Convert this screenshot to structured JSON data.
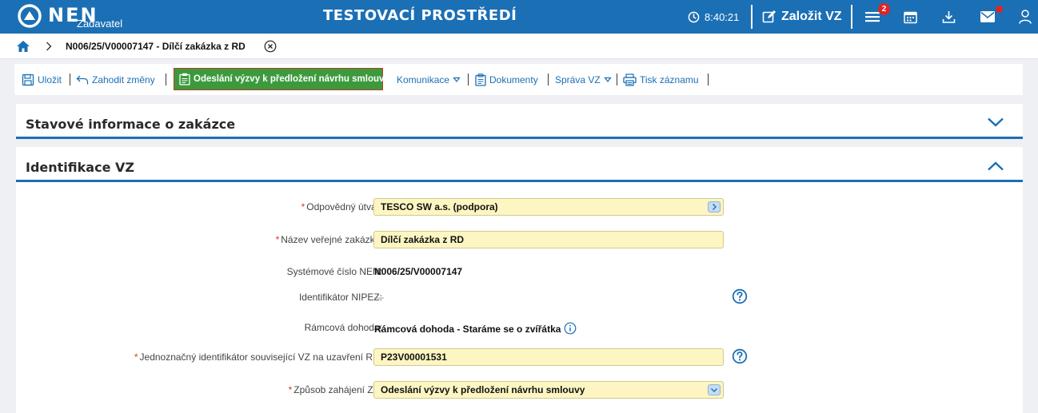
{
  "header": {
    "logo_text": "NEN",
    "logo_subtitle": "Zadavatel",
    "env_title": "TESTOVACÍ PROSTŘEDÍ",
    "clock": "8:40:21",
    "create_label": "Založit VZ",
    "menu_badge": "2"
  },
  "breadcrumb": {
    "current": "N006/25/V00007147 - Dílčí zakázka z RD"
  },
  "toolbar": {
    "save": "Uložit",
    "discard": "Zahodit změny",
    "send": "Odeslání výzvy k předložení návrhu smlouvy",
    "communication": "Komunikace",
    "documents": "Dokumenty",
    "manage": "Správa VZ",
    "print": "Tisk záznamu"
  },
  "panels": {
    "status_title": "Stavové informace o zakázce",
    "identification_title": "Identifikace VZ"
  },
  "form": {
    "responsible_unit": {
      "label": "Odpovědný útvar:",
      "value": "TESCO SW a.s. (podpora)"
    },
    "contract_name": {
      "label": "Název veřejné zakázky:",
      "value": "Dílčí zakázka z RD"
    },
    "system_number": {
      "label": "Systémové číslo NEN:",
      "value": "N006/25/V00007147"
    },
    "nipez_id": {
      "label": "Identifikátor NIPEZ:",
      "value": "—"
    },
    "framework": {
      "label": "Rámcová dohoda:",
      "value": "Rámcová dohoda - Staráme se o zvířátka"
    },
    "unique_id": {
      "label": "Jednoznačný identifikátor související VZ na uzavření RD:",
      "value": "P23V00001531"
    },
    "start_method": {
      "label": "Způsob zahájení ZP:",
      "value": "Odeslání výzvy k předložení návrhu smlouvy"
    }
  },
  "colors": {
    "brand": "#1b6fb5",
    "primary_button": "#3c9a3c",
    "input_bg": "#fdf6c3",
    "required": "#d9342b",
    "badge": "#e02424"
  }
}
